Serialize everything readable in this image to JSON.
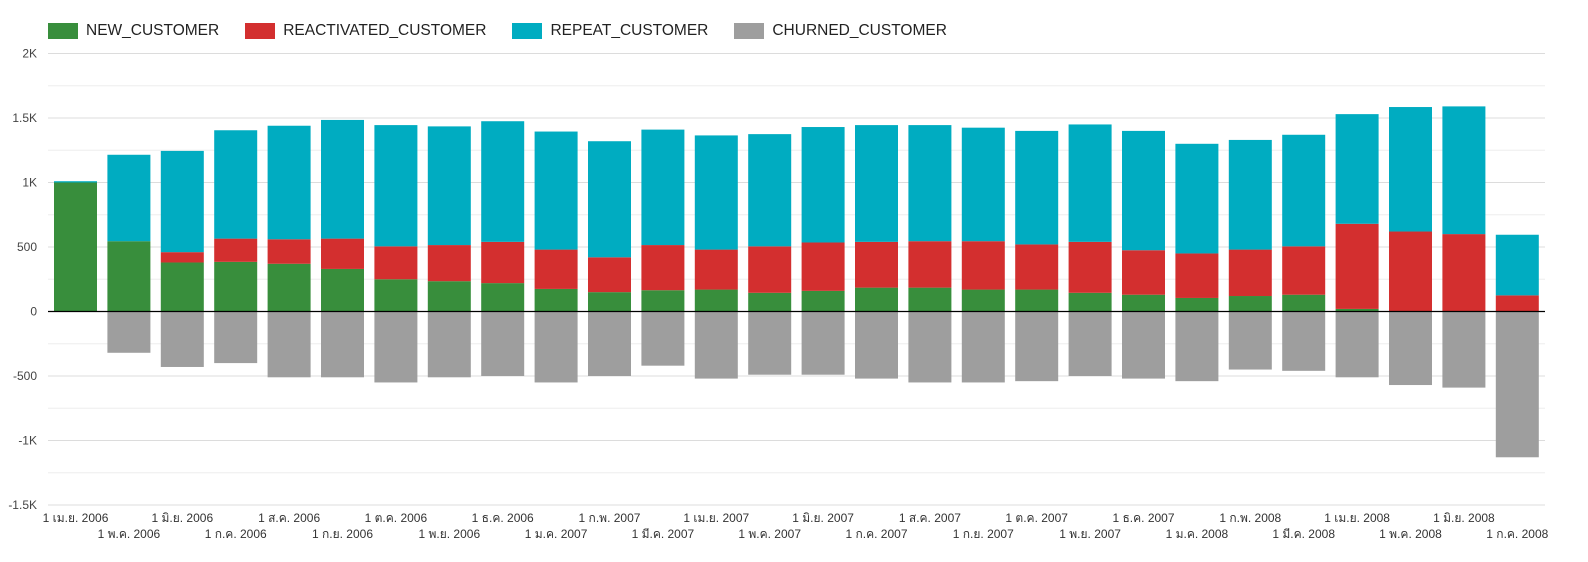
{
  "chart_data": {
    "type": "bar",
    "stacked": true,
    "categories": [
      "1 เม.ย. 2006",
      "1 พ.ค. 2006",
      "1 มิ.ย. 2006",
      "1 ก.ค. 2006",
      "1 ส.ค. 2006",
      "1 ก.ย. 2006",
      "1 ต.ค. 2006",
      "1 พ.ย. 2006",
      "1 ธ.ค. 2006",
      "1 ม.ค. 2007",
      "1 ก.พ. 2007",
      "1 มี.ค. 2007",
      "1 เม.ย. 2007",
      "1 พ.ค. 2007",
      "1 มิ.ย. 2007",
      "1 ก.ค. 2007",
      "1 ส.ค. 2007",
      "1 ก.ย. 2007",
      "1 ต.ค. 2007",
      "1 พ.ย. 2007",
      "1 ธ.ค. 2007",
      "1 ม.ค. 2008",
      "1 ก.พ. 2008",
      "1 มี.ค. 2008",
      "1 เม.ย. 2008",
      "1 พ.ค. 2008",
      "1 มิ.ย. 2008",
      "1 ก.ค. 2008"
    ],
    "series": [
      {
        "name": "NEW_CUSTOMER",
        "color": "#388e3c",
        "values": [
          1000,
          545,
          380,
          385,
          370,
          330,
          250,
          235,
          220,
          175,
          150,
          165,
          170,
          145,
          160,
          185,
          185,
          170,
          170,
          145,
          130,
          105,
          120,
          130,
          20,
          0,
          0,
          0
        ]
      },
      {
        "name": "REACTIVATED_CUSTOMER",
        "color": "#d32f2f",
        "values": [
          0,
          0,
          80,
          180,
          190,
          235,
          255,
          280,
          320,
          305,
          270,
          350,
          310,
          360,
          375,
          355,
          360,
          375,
          350,
          395,
          345,
          345,
          360,
          375,
          660,
          620,
          600,
          125
        ]
      },
      {
        "name": "REPEAT_CUSTOMER",
        "color": "#00acc1",
        "values": [
          10,
          670,
          785,
          840,
          880,
          920,
          940,
          920,
          935,
          915,
          900,
          895,
          885,
          870,
          895,
          905,
          900,
          880,
          880,
          910,
          925,
          850,
          850,
          865,
          850,
          965,
          990,
          470
        ]
      },
      {
        "name": "CHURNED_CUSTOMER",
        "color": "#9e9e9e",
        "values": [
          0,
          -320,
          -430,
          -400,
          -510,
          -510,
          -550,
          -510,
          -500,
          -550,
          -500,
          -420,
          -520,
          -490,
          -490,
          -520,
          -550,
          -550,
          -540,
          -500,
          -520,
          -540,
          -450,
          -460,
          -510,
          -570,
          -590,
          -1130
        ]
      }
    ],
    "yticks": [
      "2K",
      "1.5K",
      "1K",
      "500",
      "0",
      "-500",
      "-1K",
      "-1.5K"
    ],
    "ytick_values": [
      2000,
      1500,
      1000,
      500,
      0,
      -500,
      -1000,
      -1500
    ],
    "ylim": [
      -1500,
      2000
    ],
    "grid": true,
    "legend_position": "top-left"
  }
}
